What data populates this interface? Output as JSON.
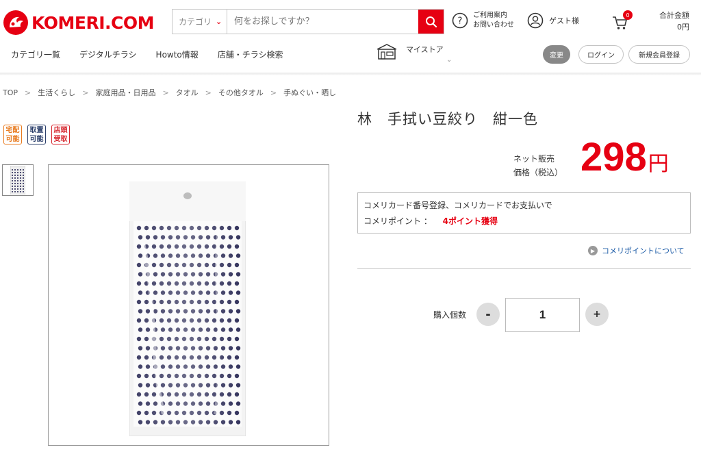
{
  "brand": {
    "name": "KOMERI.COM",
    "color": "#e60012"
  },
  "header": {
    "search": {
      "category_label": "カテゴリ",
      "placeholder": "何をお探しですか？",
      "icon": "search-icon"
    },
    "guide": {
      "line1": "ご利用案内",
      "line2": "お問い合わせ",
      "icon": "question-icon"
    },
    "guest": {
      "label": "ゲスト様",
      "icon": "user-icon"
    },
    "cart": {
      "count": "0",
      "icon": "cart-icon"
    },
    "total": {
      "label": "合計金額",
      "value": "0円"
    }
  },
  "nav": {
    "items": [
      "カテゴリ一覧",
      "デジタルチラシ",
      "Howto情報",
      "店舗・チラシ検索"
    ],
    "mystore": {
      "label": "マイストア",
      "icon": "store-icon"
    },
    "change_label": "変更",
    "login_label": "ログイン",
    "register_label": "新規会員登録"
  },
  "breadcrumb": [
    "TOP",
    "生活くらし",
    "家庭用品・日用品",
    "タオル",
    "その他タオル",
    "手ぬぐい・晒し"
  ],
  "badges": [
    {
      "line1": "宅配",
      "line2": "可能",
      "color": "#e87a1e"
    },
    {
      "line1": "取置",
      "line2": "可能",
      "color": "#2b3f6b"
    },
    {
      "line1": "店頭",
      "line2": "受取",
      "color": "#d7282f"
    }
  ],
  "product": {
    "title": "林　手拭い豆絞り　紺一色",
    "price_label_1": "ネット販売",
    "price_label_2": "価格（税込）",
    "price": "298",
    "currency": "円",
    "points_line1": "コメリカード番号登録、コメリカードでお支払いで",
    "points_label": "コメリポイント ：",
    "points_value": "4ポイント獲得",
    "points_link": "コメリポイントについて",
    "qty_label": "購入個数",
    "qty_value": "1",
    "qty_minus": "-",
    "qty_plus": "+"
  }
}
